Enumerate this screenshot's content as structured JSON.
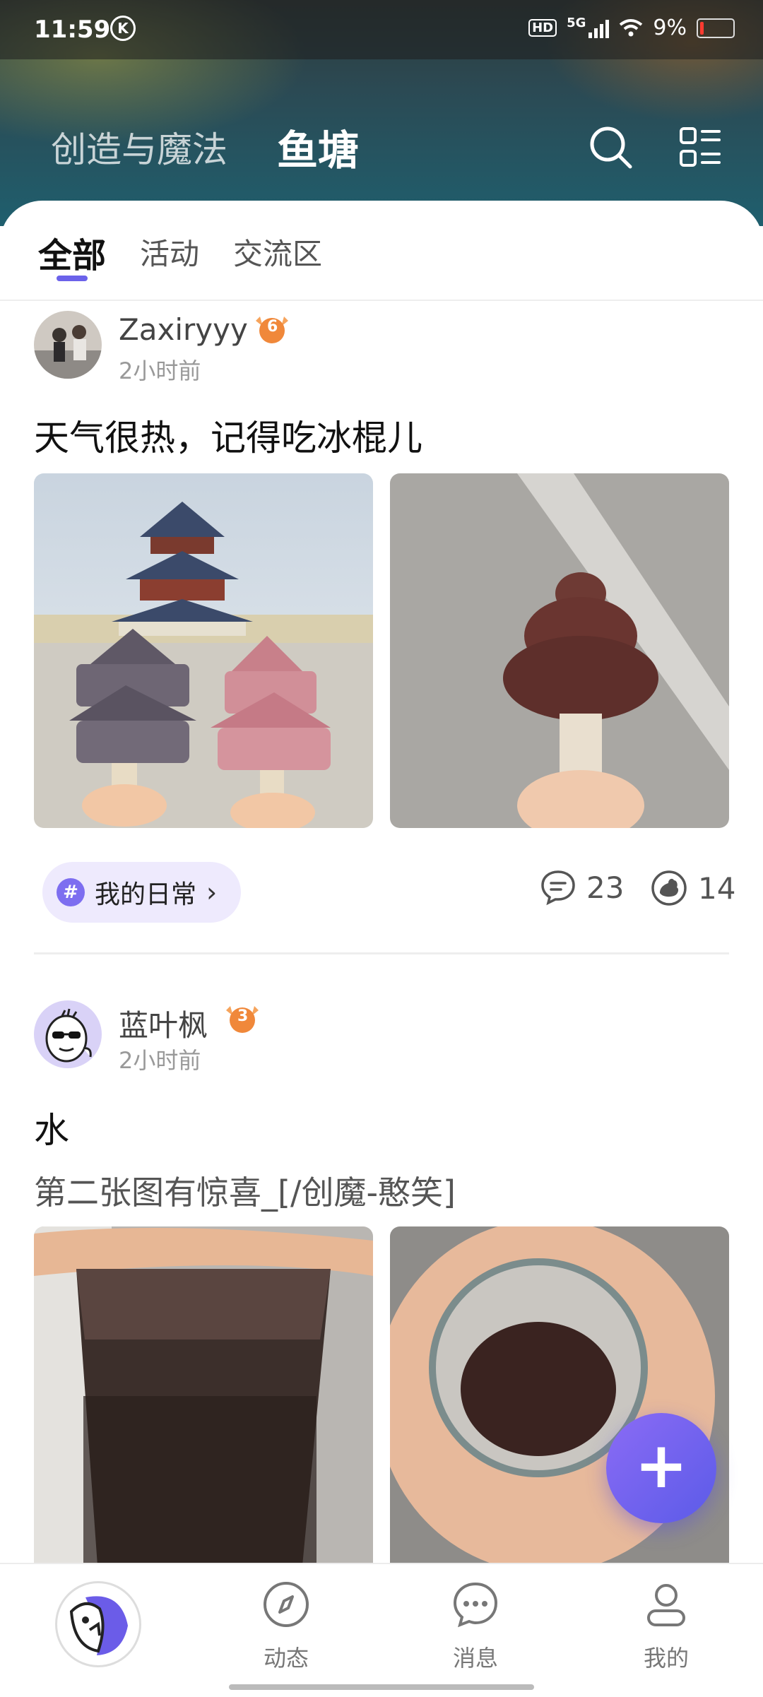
{
  "status_bar": {
    "time": "11:59",
    "k_badge": "K",
    "hd": "HD",
    "network": "5G",
    "battery": "9%"
  },
  "top_nav": {
    "tabs": [
      "创造与魔法",
      "鱼塘"
    ],
    "active_tab": "鱼塘"
  },
  "sub_tabs": {
    "items": [
      "全部",
      "活动",
      "交流区"
    ],
    "active": "全部"
  },
  "posts": [
    {
      "username": "Zaxiryyy",
      "level": "6",
      "time": "2小时前",
      "title": "天气很热，记得吃冰棍儿",
      "topic": "我的日常",
      "comments": "23",
      "likes": "14"
    },
    {
      "username": "蓝叶枫",
      "level": "3",
      "time": "2小时前",
      "title": "水",
      "text": "第二张图有惊喜_[/创魔-憨笑]"
    }
  ],
  "fab": {
    "label": "+"
  },
  "bottom_nav": {
    "items": [
      "动态",
      "消息",
      "我的"
    ]
  },
  "colors": {
    "accent": "#6b62ea",
    "chip_bg": "#eeeafd",
    "fab": "#7463f0"
  },
  "icons": [
    "search-icon",
    "menu-grid-icon",
    "comment-icon",
    "like-icon",
    "compass-icon",
    "message-icon",
    "profile-icon",
    "plus-icon",
    "hash-icon"
  ]
}
